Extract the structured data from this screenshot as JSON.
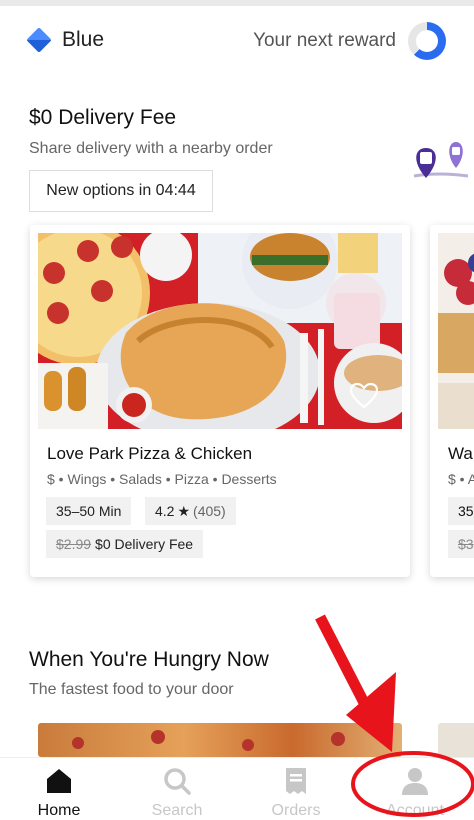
{
  "header": {
    "brand_name": "Blue",
    "reward_label": "Your next reward",
    "reward_progress": 0.62
  },
  "promo": {
    "title": "$0 Delivery Fee",
    "subtitle": "Share delivery with a nearby order",
    "timer_label": "New options in 04:44"
  },
  "restaurants": [
    {
      "name": "Love Park Pizza & Chicken",
      "tags": "$ • Wings • Salads • Pizza • Desserts",
      "time": "35–50 Min",
      "rating": "4.2",
      "rating_count": "(405)",
      "old_fee": "$2.99",
      "fee": "$0 Delivery Fee"
    },
    {
      "name": "Wa",
      "tags": "$ • A",
      "time": "35",
      "old_fee": "$3"
    }
  ],
  "section": {
    "title": "When You're Hungry Now",
    "subtitle": "The fastest food to your door"
  },
  "tabs": {
    "home": "Home",
    "search": "Search",
    "orders": "Orders",
    "account": "Account"
  },
  "colors": {
    "accent_blue": "#2a6cf0",
    "annotation_red": "#e8141b",
    "pin_purple": "#5b3fa8"
  }
}
